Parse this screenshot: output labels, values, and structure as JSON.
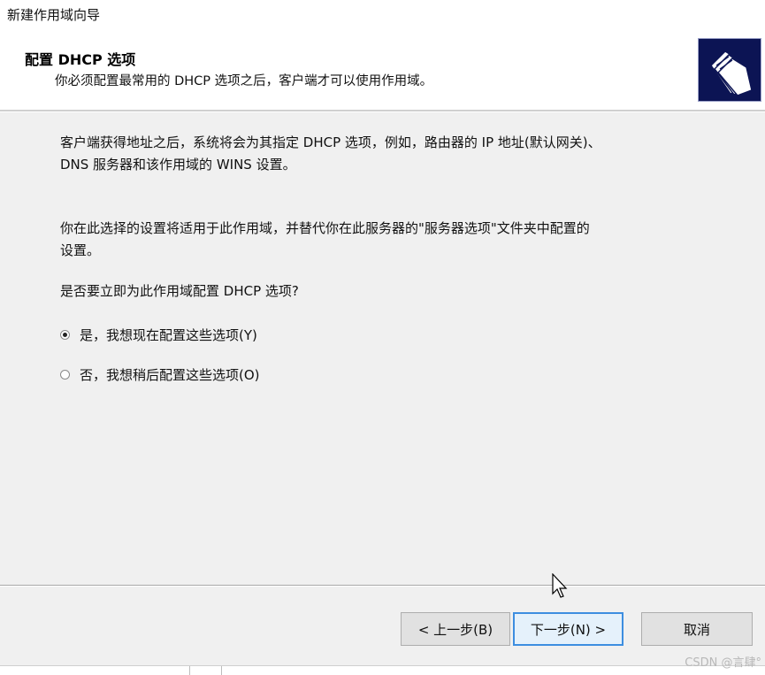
{
  "window": {
    "title": "新建作用域向导"
  },
  "header": {
    "title": "配置 DHCP 选项",
    "subtitle": "你必须配置最常用的 DHCP 选项之后，客户端才可以使用作用域。",
    "icon": "folders-icon"
  },
  "content": {
    "paragraph1": [
      "客户端获得地址之后，系统将会为其指定 DHCP 选项，例如，路由器的 IP 地址(默认网关)、",
      "DNS 服务器和该作用域的 WINS 设置。"
    ],
    "paragraph2": [
      "你在此选择的设置将适用于此作用域，并替代你在此服务器的\"服务器选项\"文件夹中配置的",
      "设置。"
    ],
    "question": "是否要立即为此作用域配置 DHCP 选项?",
    "options": [
      {
        "label": "是，我想现在配置这些选项(Y)",
        "selected": true
      },
      {
        "label": "否，我想稍后配置这些选项(O)",
        "selected": false
      }
    ]
  },
  "buttons": {
    "back": "< 上一步(B)",
    "next": "下一步(N) >",
    "cancel": "取消"
  },
  "watermark": "CSDN @言肆°",
  "colors": {
    "icon_bg": "#0c1454",
    "default_button_border": "#3d8ee0"
  }
}
